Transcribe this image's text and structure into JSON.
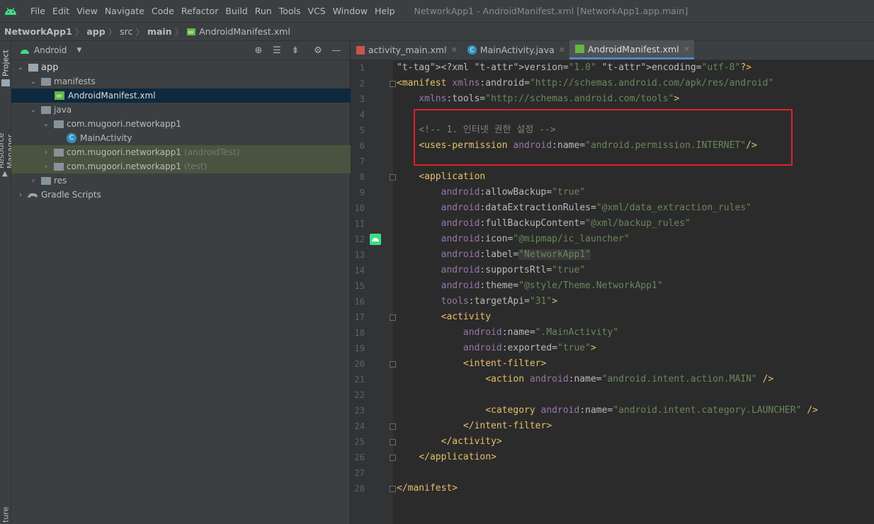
{
  "menubar": {
    "items": [
      "File",
      "Edit",
      "View",
      "Navigate",
      "Code",
      "Refactor",
      "Build",
      "Run",
      "Tools",
      "VCS",
      "Window",
      "Help"
    ],
    "title": "NetworkApp1 - AndroidManifest.xml [NetworkApp1.app.main]"
  },
  "breadcrumb": [
    "NetworkApp1",
    "app",
    "src",
    "main",
    "AndroidManifest.xml"
  ],
  "left_strip": {
    "project": "Project",
    "resource_manager": "Resource Manager",
    "structure": "ture"
  },
  "project_panel": {
    "view_selector": "Android",
    "tree": [
      {
        "label": "app",
        "icon": "module-folder-icon",
        "arrow": "v",
        "indent": 0
      },
      {
        "label": "manifests",
        "icon": "folder-icon",
        "arrow": "v",
        "indent": 1
      },
      {
        "label": "AndroidManifest.xml",
        "icon": "manifest-file-icon",
        "arrow": "",
        "indent": 2,
        "selected": true
      },
      {
        "label": "java",
        "icon": "folder-icon",
        "arrow": "v",
        "indent": 1
      },
      {
        "label": "com.mugoori.networkapp1",
        "icon": "package-icon",
        "arrow": "v",
        "indent": 2
      },
      {
        "label": "MainActivity",
        "icon": "class-icon",
        "arrow": "",
        "indent": 3
      },
      {
        "label": "com.mugoori.networkapp1",
        "icon": "package-icon",
        "arrow": ">",
        "indent": 2,
        "suffix": "(androidTest)",
        "test": true
      },
      {
        "label": "com.mugoori.networkapp1",
        "icon": "package-icon",
        "arrow": ">",
        "indent": 2,
        "suffix": "(test)",
        "test": true
      },
      {
        "label": "res",
        "icon": "res-folder-icon",
        "arrow": ">",
        "indent": 1
      },
      {
        "label": "Gradle Scripts",
        "icon": "gradle-icon",
        "arrow": ">",
        "indent": 0
      }
    ]
  },
  "tabs": [
    {
      "label": "activity_main.xml",
      "icon": "layout-file-icon",
      "active": false
    },
    {
      "label": "MainActivity.java",
      "icon": "class-icon",
      "active": false
    },
    {
      "label": "AndroidManifest.xml",
      "icon": "manifest-file-icon",
      "active": true
    }
  ],
  "code_lines": [
    "<?xml version=\"1.0\" encoding=\"utf-8\"?>",
    "<manifest xmlns:android=\"http://schemas.android.com/apk/res/android\"",
    "    xmlns:tools=\"http://schemas.android.com/tools\">",
    "",
    "    <!-- 1. 인터넷 권한 설정 -->",
    "    <uses-permission android:name=\"android.permission.INTERNET\"/>",
    "",
    "    <application",
    "        android:allowBackup=\"true\"",
    "        android:dataExtractionRules=\"@xml/data_extraction_rules\"",
    "        android:fullBackupContent=\"@xml/backup_rules\"",
    "        android:icon=\"@mipmap/ic_launcher\"",
    "        android:label=\"NetworkApp1\"",
    "        android:supportsRtl=\"true\"",
    "        android:theme=\"@style/Theme.NetworkApp1\"",
    "        tools:targetApi=\"31\">",
    "        <activity",
    "            android:name=\".MainActivity\"",
    "            android:exported=\"true\">",
    "            <intent-filter>",
    "                <action android:name=\"android.intent.action.MAIN\" />",
    "",
    "                <category android:name=\"android.intent.category.LAUNCHER\" />",
    "            </intent-filter>",
    "        </activity>",
    "    </application>",
    "",
    "</manifest>"
  ],
  "line_numbers": [
    "1",
    "2",
    "3",
    "4",
    "5",
    "6",
    "7",
    "8",
    "9",
    "10",
    "11",
    "12",
    "13",
    "14",
    "15",
    "16",
    "17",
    "18",
    "19",
    "20",
    "21",
    "22",
    "23",
    "24",
    "25",
    "26",
    "27",
    "28"
  ],
  "colors": {
    "tag": "#e8bf6a",
    "namespace": "#9876aa",
    "value": "#6a8759",
    "comment": "#808080",
    "highlight_box": "#e0202a",
    "selection": "#0d293e"
  }
}
